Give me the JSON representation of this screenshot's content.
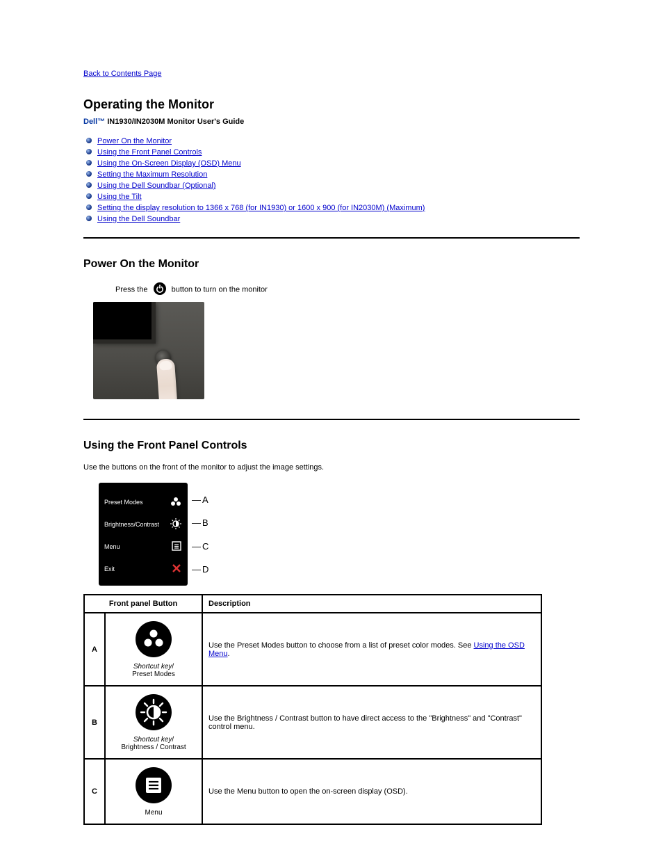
{
  "nav": {
    "back": "Back to Contents Page"
  },
  "title": "Operating the Monitor",
  "subtitle": {
    "brand": "Dell™",
    "rest": " IN1930/IN2030M Monitor User's Guide"
  },
  "toc": [
    "Using the Front Panel Controls",
    "Using the On-Screen Display (OSD) Menu",
    "Setting the Maximum Resolution",
    "Using the Dell Soundbar (Optional)",
    "Using the Tilt",
    "Power On the Monitor",
    "Setting the display resolution to 1366 x 768 (for IN1930) or 1600 x 900 (for IN2030M) (Maximum)",
    "Using the Dell Soundbar"
  ],
  "tocDisplay": [
    "Power On the Monitor",
    "Using the Front Panel Controls",
    "Using the On-Screen Display (OSD) Menu",
    "Setting the Maximum Resolution",
    "Using the Dell Soundbar (Optional)",
    "Using the Tilt",
    "Setting the display resolution to 1366 x 768 (for IN1930) or 1600 x 900 (for IN2030M) (Maximum)",
    "Using the Dell Soundbar"
  ],
  "section1": {
    "heading": "Power On the Monitor",
    "pressPrefix": "Press the ",
    "pressSuffix": " button to turn on the monitor"
  },
  "section2": {
    "heading": "Using the Front Panel Controls",
    "intro": "Use the buttons on the front of the monitor to adjust the image settings."
  },
  "panel": {
    "preset": "Preset Modes",
    "bright": "Brightness/Contrast",
    "menu": "Menu",
    "exit": "Exit",
    "A": "A",
    "B": "B",
    "C": "C",
    "D": "D"
  },
  "table": {
    "hButton": "Front panel Button",
    "hDesc": "Description",
    "rows": [
      {
        "letter": "A",
        "caption": "Preset Modes",
        "descBefore": "Use the Preset Modes button to choose from a list of preset color modes. See ",
        "link": "Using the OSD Menu",
        "descAfter": "."
      },
      {
        "letter": "B",
        "caption": "Brightness / Contrast",
        "descBefore": "Use the Brightness / Contrast button to have direct access to the \"Brightness\" and \"Contrast\" control menu.",
        "link": "",
        "descAfter": ""
      },
      {
        "letter": "C",
        "caption": "Menu",
        "descBefore": "Use the Menu button to open the on-screen display (OSD).",
        "link": "",
        "descAfter": ""
      }
    ]
  },
  "shortcutLabel": "Shortcut key"
}
